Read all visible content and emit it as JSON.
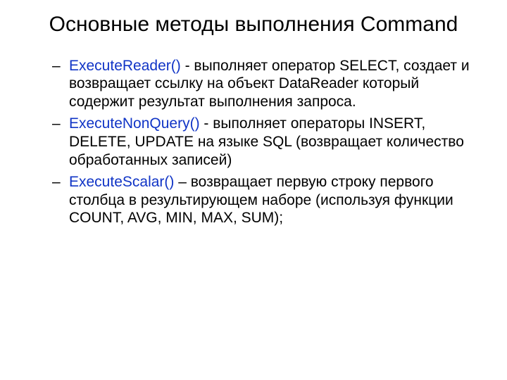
{
  "title": "Основные методы выполнения Command",
  "items": [
    {
      "method": "ExecuteReader()",
      "desc": " - выполняет оператор SELECT, создает и возвращает ссылку на объект DataReader который содержит результат выполнения запроса."
    },
    {
      "method": "ExecuteNonQuery()",
      "desc": " - выполняет операторы INSERT, DELETE, UPDATE  на языке SQL (возвращает количество обработанных записей)"
    },
    {
      "method": "ExecuteScalar()",
      "desc": " – возвращает первую строку первого столбца в результирующем наборе (используя функции COUNT, AVG, MIN, MAX, SUM);"
    }
  ]
}
